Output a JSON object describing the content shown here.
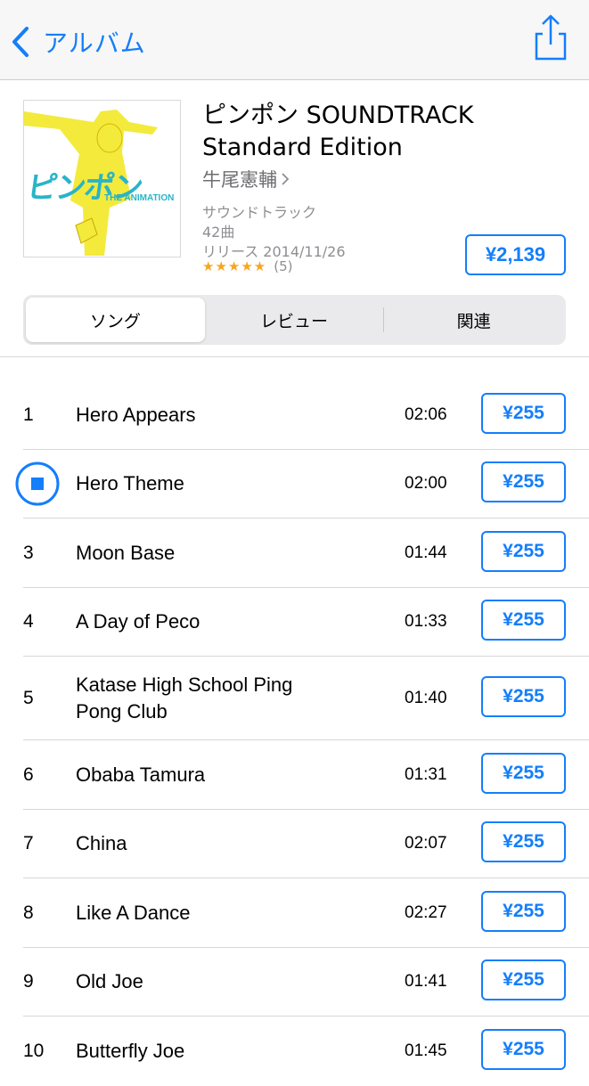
{
  "nav": {
    "back_label": "アルバム",
    "accent": "#147efb"
  },
  "album": {
    "title": "ピンポン SOUNDTRACK Standard Edition",
    "artist": "牛尾憲輔",
    "genre": "サウンドトラック",
    "song_count": "42曲",
    "release": "リリース 2014/11/26",
    "stars": "★★★★★",
    "rating_count": "(5)",
    "price": "¥2,139",
    "art": {
      "logo_text": "ピンポン",
      "subtitle": "THE ANIMATION"
    }
  },
  "tabs": [
    {
      "label": "ソング",
      "active": true
    },
    {
      "label": "レビュー",
      "active": false
    },
    {
      "label": "関連",
      "active": false
    }
  ],
  "tracks": [
    {
      "num": "1",
      "name": "Hero Appears",
      "duration": "02:06",
      "price": "¥255"
    },
    {
      "num": "",
      "playing": true,
      "name": "Hero Theme",
      "duration": "02:00",
      "price": "¥255"
    },
    {
      "num": "3",
      "name": "Moon Base",
      "duration": "01:44",
      "price": "¥255"
    },
    {
      "num": "4",
      "name": "A Day of Peco",
      "duration": "01:33",
      "price": "¥255"
    },
    {
      "num": "5",
      "name": "Katase High School Ping Pong Club",
      "duration": "01:40",
      "price": "¥255"
    },
    {
      "num": "6",
      "name": "Obaba Tamura",
      "duration": "01:31",
      "price": "¥255"
    },
    {
      "num": "7",
      "name": "China",
      "duration": "02:07",
      "price": "¥255"
    },
    {
      "num": "8",
      "name": "Like A Dance",
      "duration": "02:27",
      "price": "¥255"
    },
    {
      "num": "9",
      "name": "Old Joe",
      "duration": "01:41",
      "price": "¥255"
    },
    {
      "num": "10",
      "name": "Butterfly Joe",
      "duration": "01:45",
      "price": "¥255"
    }
  ]
}
